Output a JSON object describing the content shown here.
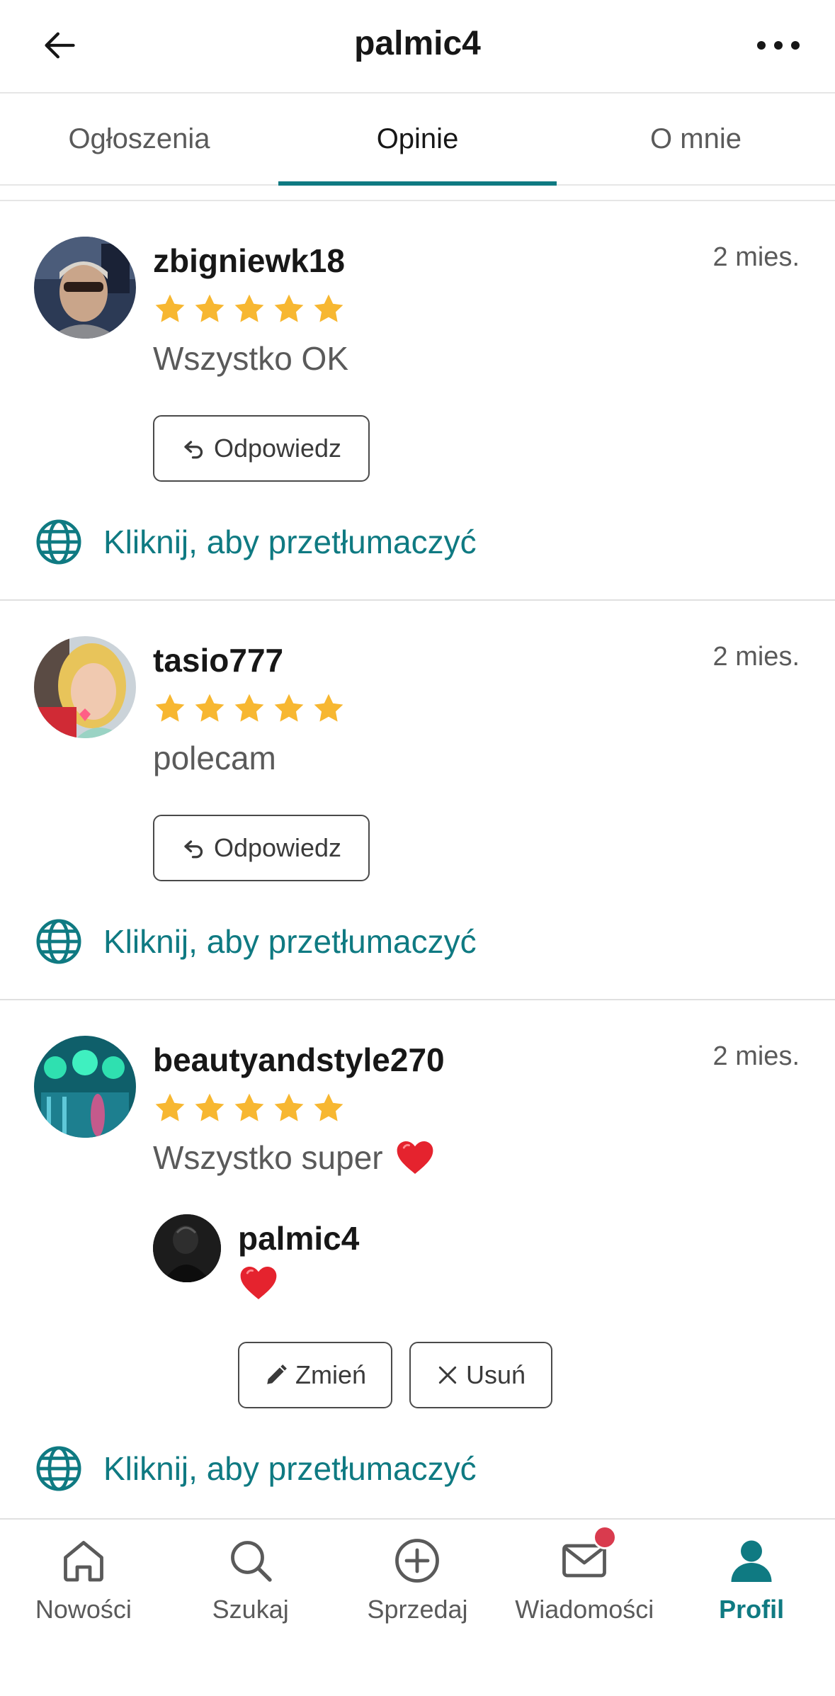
{
  "header": {
    "title": "palmic4",
    "back_icon": "arrow-left-icon",
    "more_icon": "more-horizontal-icon"
  },
  "tabs": [
    {
      "label": "Ogłoszenia",
      "active": false
    },
    {
      "label": "Opinie",
      "active": true
    },
    {
      "label": "O mnie",
      "active": false
    }
  ],
  "reviews": [
    {
      "username": "zbigniewk18",
      "time": "2 mies.",
      "rating": 5,
      "comment": "Wszystko OK",
      "reply_label": "Odpowiedz",
      "translate_label": "Kliknij, aby przetłumaczyć"
    },
    {
      "username": "tasio777",
      "time": "2 mies.",
      "rating": 5,
      "comment": "polecam",
      "reply_label": "Odpowiedz",
      "translate_label": "Kliknij, aby przetłumaczyć"
    },
    {
      "username": "beautyandstyle270",
      "time": "2 mies.",
      "rating": 5,
      "comment": "Wszystko super",
      "comment_emoji": "heart-emoji",
      "seller_reply": {
        "username": "palmic4",
        "emoji": "heart-emoji"
      },
      "edit_label": "Zmień",
      "delete_label": "Usuń",
      "translate_label": "Kliknij, aby przetłumaczyć"
    }
  ],
  "bottom_nav": [
    {
      "label": "Nowości",
      "icon": "home-icon",
      "active": false
    },
    {
      "label": "Szukaj",
      "icon": "search-icon",
      "active": false
    },
    {
      "label": "Sprzedaj",
      "icon": "plus-circle-icon",
      "active": false
    },
    {
      "label": "Wiadomości",
      "icon": "mail-icon",
      "active": false,
      "has_badge": true
    },
    {
      "label": "Profil",
      "icon": "person-icon",
      "active": true
    }
  ],
  "colors": {
    "accent": "#0f7a82",
    "star": "#f7b731",
    "badge": "#d93b4e",
    "heart": "#e5232e"
  }
}
